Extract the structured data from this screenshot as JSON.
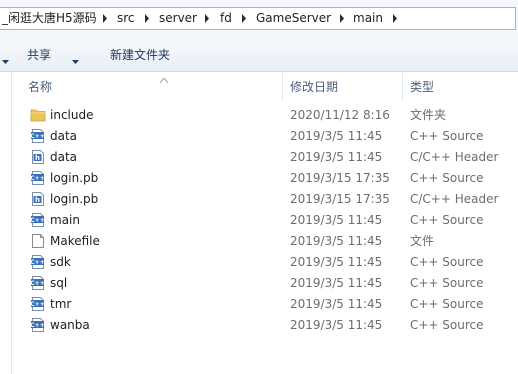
{
  "address": {
    "crumbs": [
      "_闲逛大唐H5源码",
      "src",
      "server",
      "fd",
      "GameServer",
      "main"
    ]
  },
  "toolbar": {
    "share_label": "共享",
    "new_folder_label": "新建文件夹"
  },
  "columns": {
    "name": "名称",
    "modified": "修改日期",
    "type": "类型"
  },
  "files": [
    {
      "name": "include",
      "date": "2020/11/12 8:16",
      "type": "文件夹",
      "icon": "folder-icon"
    },
    {
      "name": "data",
      "date": "2019/3/5 11:45",
      "type": "C++ Source",
      "icon": "cpp-source-icon"
    },
    {
      "name": "data",
      "date": "2019/3/5 11:45",
      "type": "C/C++ Header",
      "icon": "header-file-icon"
    },
    {
      "name": "login.pb",
      "date": "2019/3/15 17:35",
      "type": "C++ Source",
      "icon": "cpp-source-icon"
    },
    {
      "name": "login.pb",
      "date": "2019/3/15 17:35",
      "type": "C/C++ Header",
      "icon": "header-file-icon"
    },
    {
      "name": "main",
      "date": "2019/3/5 11:45",
      "type": "C++ Source",
      "icon": "cpp-source-icon"
    },
    {
      "name": "Makefile",
      "date": "2019/3/5 11:45",
      "type": "文件",
      "icon": "blank-file-icon"
    },
    {
      "name": "sdk",
      "date": "2019/3/5 11:45",
      "type": "C++ Source",
      "icon": "cpp-source-icon"
    },
    {
      "name": "sql",
      "date": "2019/3/5 11:45",
      "type": "C++ Source",
      "icon": "cpp-source-icon"
    },
    {
      "name": "tmr",
      "date": "2019/3/5 11:45",
      "type": "C++ Source",
      "icon": "cpp-source-icon"
    },
    {
      "name": "wanba",
      "date": "2019/3/5 11:45",
      "type": "C++ Source",
      "icon": "cpp-source-icon"
    }
  ],
  "colors": {
    "command_text": "#1e3a66",
    "header_text": "#4c607a",
    "meta_text": "#6d6d6d",
    "folder": "#e8c45a",
    "cpp_badge": "#3b6fb6"
  }
}
